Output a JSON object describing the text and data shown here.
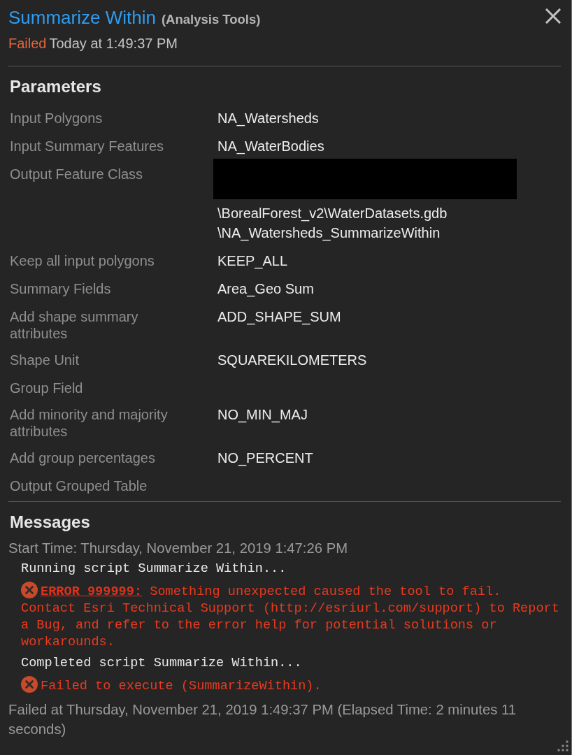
{
  "header": {
    "tool_name": "Summarize Within",
    "toolbox": "(Analysis Tools)",
    "status": {
      "text": "Failed",
      "kind": "failed"
    },
    "time": "Today at 1:49:37 PM"
  },
  "parameters": {
    "heading": "Parameters",
    "rows": [
      {
        "label": "Input Polygons",
        "value": "NA_Watersheds"
      },
      {
        "label": "Input Summary Features",
        "value": "NA_WaterBodies"
      },
      {
        "label": "Output Feature Class",
        "redacted": true,
        "value_lines": [
          "\\BorealForest_v2\\WaterDatasets.gdb",
          "\\NA_Watersheds_SummarizeWithin"
        ]
      },
      {
        "label": "Keep all input polygons",
        "value": "KEEP_ALL"
      },
      {
        "label": "Summary Fields",
        "value": "Area_Geo Sum"
      },
      {
        "label": "Add shape summary attributes",
        "value": "ADD_SHAPE_SUM"
      },
      {
        "label": "Shape Unit",
        "value": "SQUAREKILOMETERS"
      },
      {
        "label": "Group Field"
      },
      {
        "label": "Add minority and majority attributes",
        "value": "NO_MIN_MAJ"
      },
      {
        "label": "Add group percentages",
        "value": "NO_PERCENT"
      },
      {
        "label": "Output Grouped Table"
      }
    ]
  },
  "messages": {
    "heading": "Messages",
    "start": "Start Time: Thursday, November 21, 2019 1:47:26 PM",
    "items": [
      {
        "kind": "info",
        "text": "Running script Summarize Within..."
      },
      {
        "kind": "error",
        "code": "ERROR 999999:",
        "text": "Something unexpected caused the tool to fail. Contact Esri Technical Support (http://esriurl.com/support) to Report a Bug, and refer to the error help for potential solutions or workarounds."
      },
      {
        "kind": "info",
        "text": "Completed script Summarize Within..."
      },
      {
        "kind": "error",
        "text": "Failed to execute (SummarizeWithin)."
      }
    ],
    "end": "Failed at Thursday, November 21, 2019 1:49:37 PM (Elapsed Time: 2 minutes 11 seconds)"
  }
}
